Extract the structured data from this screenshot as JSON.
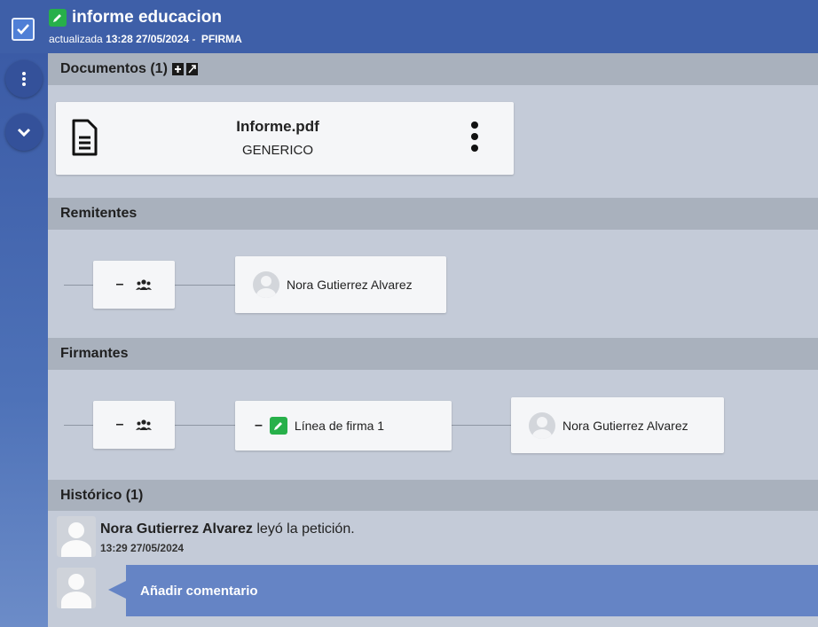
{
  "header": {
    "title": "informe educacion",
    "updated_prefix": "actualizada",
    "updated_datetime": "13:28 27/05/2024",
    "separator": "-",
    "status": "PFIRMA"
  },
  "rail": {
    "menu_icon": "vertical-dots-icon",
    "collapse_icon": "chevron-down-icon"
  },
  "sections": {
    "documents": "Documentos (1)",
    "senders": "Remitentes",
    "signers": "Firmantes",
    "history": "Histórico (1)"
  },
  "document": {
    "name": "Informe.pdf",
    "type": "GENERICO"
  },
  "senders": {
    "group_dash": "–",
    "person": "Nora Gutierrez Alvarez"
  },
  "signers": {
    "group_dash": "–",
    "line_dash": "–",
    "line_label": "Línea de firma 1",
    "person": "Nora Gutierrez Alvarez"
  },
  "history": {
    "entries": [
      {
        "user": "Nora Gutierrez Alvarez",
        "action": "leyó la petición.",
        "datetime": "13:29 27/05/2024"
      }
    ],
    "comment_placeholder": "Añadir comentario"
  },
  "colors": {
    "header": "#3e5fa8",
    "accent_green": "#27b04a",
    "comment": "#6584c5"
  }
}
